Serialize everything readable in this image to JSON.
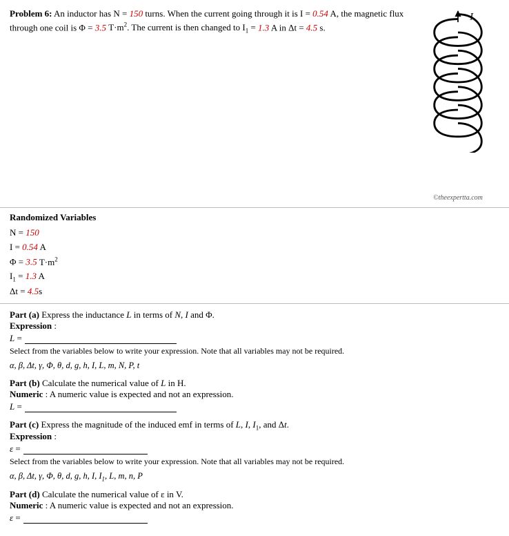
{
  "problem": {
    "label": "Problem 6:",
    "intro": "An inductor has ",
    "N_label": "N = ",
    "N_val": "150",
    "turns_text": " turns. When the current going through it is ",
    "I_label": "I = ",
    "I_val": "0.54",
    "I_unit": " A, the magnetic flux through one coil is ",
    "phi_label": "Φ = ",
    "phi_val": "3.5",
    "phi_unit": " T·m². The current is then changed to ",
    "I1_label": "I₁ = ",
    "I1_val": "1.3",
    "I1_unit": " A in ",
    "dt_label": "Δt = ",
    "dt_val": "4.5",
    "dt_unit": " s."
  },
  "randomized": {
    "title": "Randomized Variables",
    "vars": [
      {
        "label": "N = ",
        "val": "150"
      },
      {
        "label": "I = ",
        "val": "0.54",
        "unit": " A"
      },
      {
        "label": "Φ = ",
        "val": "3.5",
        "unit": " T·m²"
      },
      {
        "label": "I₁ = ",
        "val": "1.3",
        "unit": " A"
      },
      {
        "label": "Δt = ",
        "val": "4.5",
        "unit": "s"
      }
    ]
  },
  "parts": {
    "a": {
      "label": "Part (a)",
      "description": "Express the inductance L in terms of N, I and Φ.",
      "type_label": "Expression",
      "colon": ":",
      "lhs": "L =",
      "hint": "Select from the variables below to write your expression. Note that all variables may not be required.",
      "vars": "α, β, Δt, γ, Φ, θ, d, g, h, I, L, m, N, P, t"
    },
    "b": {
      "label": "Part (b)",
      "description": "Calculate the numerical value of L in H.",
      "type_label": "Numeric",
      "colon": ": A numeric value is expected and not an expression.",
      "lhs": "L ="
    },
    "c": {
      "label": "Part (c)",
      "description": "Express the magnitude of the induced emf in terms of L, I, I₁, and Δt.",
      "type_label": "Expression",
      "colon": ":",
      "lhs": "ε =",
      "hint": "Select from the variables below to write your expression. Note that all variables may not be required.",
      "vars": "α, β, Δt, γ, Φ, θ, d, g, h, I, I₁, L, m, n, P"
    },
    "d": {
      "label": "Part (d)",
      "description": "Calculate the numerical value of ε in V.",
      "type_label": "Numeric",
      "colon": ": A numeric value is expected and not an expression.",
      "lhs": "ε ="
    }
  },
  "watermark": "©theexpertta.com",
  "icons": {
    "coil": "coil-inductor"
  }
}
